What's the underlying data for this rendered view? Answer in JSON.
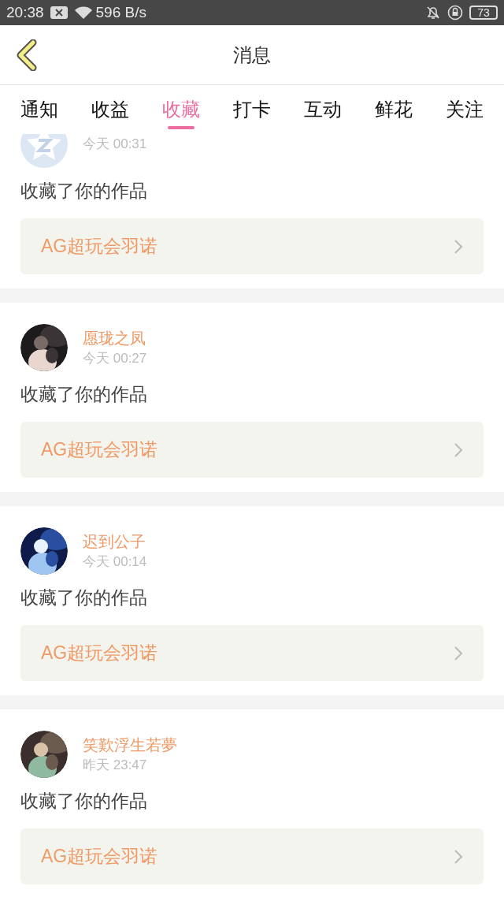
{
  "status_bar": {
    "time": "20:38",
    "speed": "596 B/s",
    "battery": "73"
  },
  "header": {
    "title": "消息"
  },
  "tabs": [
    {
      "label": "通知",
      "selected": false
    },
    {
      "label": "收益",
      "selected": false
    },
    {
      "label": "收藏",
      "selected": true
    },
    {
      "label": "打卡",
      "selected": false
    },
    {
      "label": "互动",
      "selected": false
    },
    {
      "label": "鲜花",
      "selected": false
    },
    {
      "label": "关注",
      "selected": false
    }
  ],
  "items": [
    {
      "avatar": {
        "kind": "logo"
      },
      "time": "今天 00:31",
      "message": "收藏了你的作品",
      "work": "AG超玩会羽诺"
    },
    {
      "name": "愿珑之凤",
      "time": "今天 00:27",
      "message": "收藏了你的作品",
      "work": "AG超玩会羽诺"
    },
    {
      "name": "迟到公子",
      "time": "今天 00:14",
      "message": "收藏了你的作品",
      "work": "AG超玩会羽诺"
    },
    {
      "name": "笑歎浮生若夢",
      "time": "昨天 23:47",
      "message": "收藏了你的作品",
      "work": "AG超玩会羽诺"
    }
  ]
}
